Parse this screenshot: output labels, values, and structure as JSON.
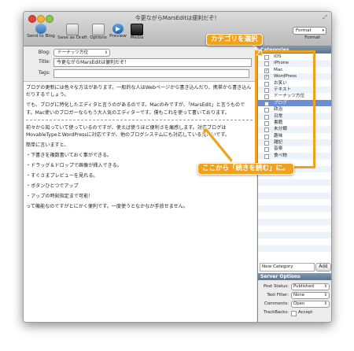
{
  "window": {
    "title": "今更ながらMarsEditは便利だぞ！"
  },
  "toolbar": {
    "send_label": "Send to Blog",
    "draft_label": "Save as Draft",
    "options_label": "Options",
    "preview_label": "Preview",
    "media_label": "Media",
    "format_value": "Format",
    "format_label": "Format"
  },
  "meta": {
    "blog_label": "Blog:",
    "blog_value": "ドーナッツ方位",
    "title_label": "Title:",
    "title_value": "今更ながらMarsEditは便利だぞ！",
    "tags_label": "Tags:",
    "tags_value": ""
  },
  "body": {
    "p1": "ブログの更新には色々な方法があります。一般的な人はWebページから書き込んだり、携帯から書き込んだりするでしょう。",
    "p2": "でも、ブログに特化したエディタと言うのがあるのです。Macのみですが、「MarsEdit」と言うものです。Mac使いのブロガーならもう大人気のエディターです。僕もこれを使って書いております。",
    "p3": "前々から知っていて使っているのですが、使えば使うほど便利さを痛感します。対応ブログはMovableTypeとWordPressに対応ですが、他のブログシステムにも対応している見たいです。",
    "p4": "簡単に言いますと、",
    "p5": "・下書きを複数書いておく事ができる。",
    "p6": "・ドラッグ＆ドロップで画像が挿入できる。",
    "p7": "・すぐさまプレビューを見れる。",
    "p8": "・ボタンひとつでアップ",
    "p9": "・アップの時刻指定まで可能！",
    "p10": "って機能なのですがとにかく便利です。一度使うとなかなか手放せません。"
  },
  "categories": {
    "header": "Categories",
    "items": [
      {
        "label": "iOS",
        "checked": false
      },
      {
        "label": "iPhone",
        "checked": false
      },
      {
        "label": "Mac",
        "checked": true
      },
      {
        "label": "WordPress",
        "checked": true
      },
      {
        "label": "お笑い",
        "checked": false
      },
      {
        "label": "テキスト",
        "checked": false
      },
      {
        "label": "ドーナッツ方位",
        "checked": false
      },
      {
        "label": "ブログ",
        "checked": true
      },
      {
        "label": "政治",
        "checked": false
      },
      {
        "label": "日常",
        "checked": false
      },
      {
        "label": "書籍",
        "checked": false
      },
      {
        "label": "未分類",
        "checked": false
      },
      {
        "label": "趣味",
        "checked": false
      },
      {
        "label": "雑記",
        "checked": false
      },
      {
        "label": "音楽",
        "checked": false
      },
      {
        "label": "食べ物",
        "checked": false
      }
    ],
    "new_placeholder": "New Category",
    "add_label": "Add"
  },
  "server_options": {
    "header": "Server Options",
    "post_status_label": "Post Status:",
    "post_status_value": "Published",
    "text_filter_label": "Text Filter:",
    "text_filter_value": "None",
    "comments_label": "Comments:",
    "comments_value": "Open",
    "trackbacks_label": "TrackBacks:",
    "accept_label": "Accept"
  },
  "annotations": {
    "category_callout": "カテゴリを選択",
    "more_callout": "ここから「続きを読む」に。",
    "color": "#f0a21c"
  }
}
